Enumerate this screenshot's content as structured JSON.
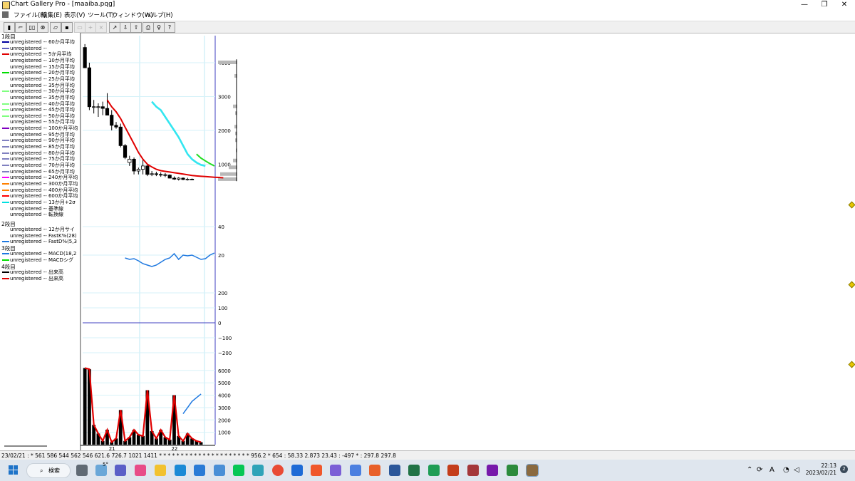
{
  "window": {
    "title": "Chart Gallery Pro - [maaiba.pqg]",
    "minimize": "—",
    "restore": "❐",
    "close": "✕"
  },
  "menu": [
    "ファイル(F)",
    "編集(E)",
    "表示(V)",
    "ツール(T)",
    "ウィンドウ(W)",
    "ヘルプ(H)"
  ],
  "toolbar": [
    {
      "name": "chart-type-button",
      "glyph": "▮"
    },
    {
      "name": "line-chart-button",
      "glyph": "⌐"
    },
    {
      "name": "compare-button",
      "glyph": "▯▯"
    },
    {
      "name": "find-button",
      "glyph": "⊗"
    },
    {
      "name": "open-button",
      "glyph": "▱"
    },
    {
      "name": "save-button",
      "glyph": "▪"
    },
    {
      "name": "copy-button",
      "glyph": "▭",
      "disabled": true
    },
    {
      "name": "crosshair-button",
      "glyph": "+",
      "disabled": true
    },
    {
      "name": "delete-button",
      "glyph": "×",
      "disabled": true
    },
    {
      "name": "draw-line-button",
      "glyph": "↗"
    },
    {
      "name": "arrow-down-button",
      "glyph": "⇩"
    },
    {
      "name": "arrow-up-button",
      "glyph": "⇧"
    },
    {
      "name": "print-button",
      "glyph": "⎙"
    },
    {
      "name": "hint-button",
      "glyph": "♀"
    },
    {
      "name": "help-button",
      "glyph": "?"
    }
  ],
  "legend": {
    "sections": [
      "1段目",
      "2段目",
      "3段目",
      "4段目"
    ],
    "panel1": [
      {
        "text": "unregistered -- 60か月平均",
        "color": "#0000a0"
      },
      {
        "text": "unregistered --",
        "color": "#6060c0"
      },
      {
        "text": "unregistered -- 5か月平均",
        "color": "#e00000"
      },
      {
        "text": "unregistered -- 10か月平均",
        "color": ""
      },
      {
        "text": "unregistered -- 15か月平均",
        "color": ""
      },
      {
        "text": "unregistered -- 20か月平均",
        "color": "#00dd00"
      },
      {
        "text": "unregistered -- 25か月平均",
        "color": ""
      },
      {
        "text": "unregistered -- 35か月平均",
        "color": ""
      },
      {
        "text": "unregistered -- 30か月平均",
        "color": "#80ff80"
      },
      {
        "text": "unregistered -- 35か月平均",
        "color": ""
      },
      {
        "text": "unregistered -- 40か月平均",
        "color": "#80ff80"
      },
      {
        "text": "unregistered -- 45か月平均",
        "color": "#80ff80"
      },
      {
        "text": "unregistered -- 50か月平均",
        "color": "#80ff80"
      },
      {
        "text": "unregistered -- 55か月平均",
        "color": ""
      },
      {
        "text": "unregistered -- 100か月平均",
        "color": "#8000c0"
      },
      {
        "text": "unregistered -- 95か月平均",
        "color": ""
      },
      {
        "text": "unregistered -- 90か月平均",
        "color": "#8080c0"
      },
      {
        "text": "unregistered -- 85か月平均",
        "color": "#8080c0"
      },
      {
        "text": "unregistered -- 80か月平均",
        "color": "#8080c0"
      },
      {
        "text": "unregistered -- 75か月平均",
        "color": "#8080c0"
      },
      {
        "text": "unregistered -- 70か月平均",
        "color": "#8080c0"
      },
      {
        "text": "unregistered -- 65か月平均",
        "color": "#8080c0"
      },
      {
        "text": "unregistered -- 240か月平均",
        "color": "#ff00ff"
      },
      {
        "text": "unregistered -- 300か月平均",
        "color": "#ff8000"
      },
      {
        "text": "unregistered -- 400か月平均",
        "color": "#ff8000"
      },
      {
        "text": "unregistered -- 600か月平均",
        "color": "#ff0000"
      },
      {
        "text": "unregistered -- 13か月+2σ",
        "color": "#00e0e0"
      },
      {
        "text": "unregistered -- 基準線",
        "color": ""
      },
      {
        "text": "unregistered -- 転換線",
        "color": ""
      }
    ],
    "panel2": [
      {
        "text": "unregistered -- 12か月サイ",
        "color": ""
      },
      {
        "text": "unregistered -- FastK%(28)",
        "color": ""
      },
      {
        "text": "unregistered -- FastD%(5,3",
        "color": "#1e78e0"
      }
    ],
    "panel3": [
      {
        "text": "unregistered -- MACD(18,2",
        "color": "#1e78e0"
      },
      {
        "text": "unregistered -- MACDシグ",
        "color": "#00dd00"
      }
    ],
    "panel4": [
      {
        "text": "unregistered -- 出来高",
        "color": "#000000"
      },
      {
        "text": "unregistered -- 出来高",
        "color": "#e00000"
      }
    ]
  },
  "chart_data": {
    "type": "line",
    "periods": 30,
    "x_labels": [
      {
        "i": 6,
        "label": "21"
      },
      {
        "i": 20,
        "label": "22"
      }
    ],
    "panel1": {
      "y_ticks": [
        1000,
        2000,
        3000,
        4000
      ],
      "ylim": [
        0,
        4800
      ],
      "candles": [
        [
          4450,
          4550,
          3850,
          3850
        ],
        [
          3850,
          4000,
          2600,
          2700
        ],
        [
          2700,
          2900,
          2500,
          2700
        ],
        [
          2700,
          2800,
          2400,
          2700
        ],
        [
          2700,
          2850,
          2450,
          2650
        ],
        [
          2650,
          3100,
          2450,
          2450
        ],
        [
          2450,
          2600,
          2000,
          2150
        ],
        [
          2150,
          2250,
          2050,
          2100
        ],
        [
          2100,
          2200,
          1500,
          1550
        ],
        [
          1550,
          1600,
          1150,
          1200
        ],
        [
          1050,
          1250,
          950,
          1150
        ],
        [
          1150,
          1200,
          700,
          800
        ],
        [
          800,
          900,
          700,
          850
        ],
        [
          850,
          1150,
          700,
          950
        ],
        [
          950,
          1000,
          650,
          700
        ],
        [
          700,
          800,
          650,
          720
        ],
        [
          720,
          780,
          650,
          700
        ],
        [
          700,
          760,
          630,
          690
        ],
        [
          690,
          740,
          620,
          680
        ],
        [
          680,
          700,
          580,
          590
        ],
        [
          590,
          640,
          540,
          560
        ],
        [
          560,
          620,
          520,
          590
        ],
        [
          590,
          610,
          530,
          550
        ],
        [
          550,
          600,
          520,
          560
        ],
        [
          560,
          580,
          540,
          550
        ]
      ],
      "ma_red": [
        2900,
        2700,
        2550,
        2350,
        2100,
        1850,
        1600,
        1350,
        1150,
        1000,
        920,
        850,
        810,
        790,
        770,
        750,
        730,
        710,
        690,
        670,
        655,
        645,
        635,
        625,
        615,
        610,
        600
      ],
      "ma_cyan": [
        2850,
        2700,
        2600,
        2400,
        2200,
        2000,
        1800,
        1550,
        1300,
        1150,
        1050,
        980,
        950
      ],
      "ma_green": [
        1300,
        1180,
        1100,
        1020,
        950
      ]
    },
    "panel2": {
      "y_ticks": [
        20,
        40
      ],
      "ylim": [
        0,
        45
      ],
      "fastd": [
        18,
        17,
        17.5,
        16,
        14,
        13,
        12,
        13,
        15,
        17,
        18,
        21,
        17,
        20,
        19.5,
        20,
        18.5,
        17,
        17.5,
        20,
        21.5
      ]
    },
    "panel3": {
      "y_ticks": [
        -200,
        -100,
        0,
        100,
        200
      ]
    },
    "panel4": {
      "y_ticks": [
        1000,
        2000,
        3000,
        4000,
        5000,
        6000
      ],
      "ylim": [
        0,
        6800
      ],
      "volume": [
        6200,
        6100,
        1600,
        900,
        300,
        1200,
        200,
        500,
        2800,
        300,
        600,
        1200,
        800,
        700,
        4400,
        1100,
        500,
        1200,
        600,
        400,
        4000,
        700,
        300,
        900,
        500,
        300,
        200
      ],
      "volume_line": [
        2500,
        3000,
        3500,
        3800,
        4100
      ]
    }
  },
  "status_text": "23/02/21 : * 561 586 544 562 546 621.6 726.7 1021 1411 * * * * * * * * * * * * * * * * * * * * * 956.2 * 654 : 58.33 2.873 23.43 : -497 * : 297.8 297.8",
  "taskbar": {
    "search_label": "検索",
    "weather": "5°",
    "time": "22:13",
    "date": "2023/02/21",
    "ime": "A",
    "badge": "2"
  }
}
